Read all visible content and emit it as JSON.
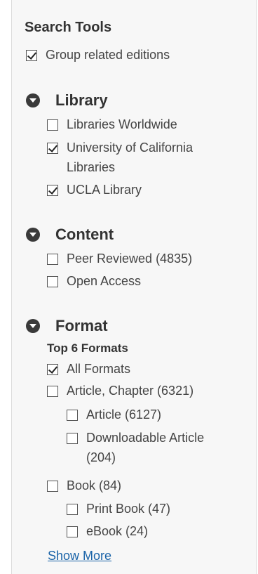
{
  "search_tools": {
    "title": "Search Tools",
    "group_related": {
      "label": "Group related editions",
      "checked": true
    }
  },
  "library": {
    "heading": "Library",
    "toggle_icon": "chevron-down-circle-icon",
    "items": [
      {
        "label": "Libraries Worldwide",
        "checked": false
      },
      {
        "label_line1": "University of California",
        "label_line2": "Libraries",
        "checked": true
      },
      {
        "label": "UCLA Library",
        "checked": true
      }
    ]
  },
  "content": {
    "heading": "Content",
    "toggle_icon": "chevron-down-circle-icon",
    "items": [
      {
        "label": "Peer Reviewed (4835)",
        "checked": false
      },
      {
        "label": "Open Access",
        "checked": false
      }
    ]
  },
  "format": {
    "heading": "Format",
    "toggle_icon": "chevron-down-circle-icon",
    "subheading": "Top 6 Formats",
    "items": [
      {
        "label": "All Formats",
        "checked": true
      },
      {
        "label": "Article, Chapter (6321)",
        "checked": false
      },
      {
        "label": "Article (6127)",
        "checked": false
      },
      {
        "label_line1": "Downloadable Article",
        "label_line2": "(204)",
        "checked": false
      },
      {
        "label": "Book (84)",
        "checked": false
      },
      {
        "label": "Print Book (47)",
        "checked": false
      },
      {
        "label": "eBook (24)",
        "checked": false
      }
    ],
    "show_more": "Show More"
  },
  "colors": {
    "panel_bg": "#f7f7f7",
    "link": "#1a63a8",
    "toggle": "#3a3a3a"
  }
}
